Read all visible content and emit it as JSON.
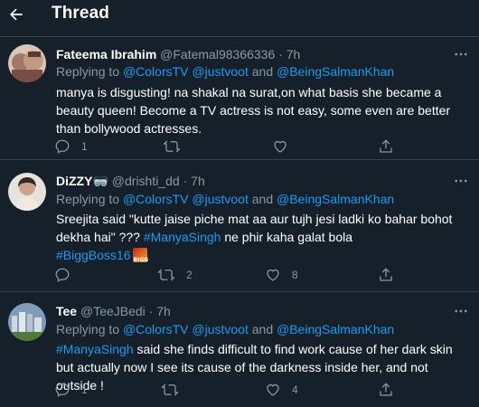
{
  "header": {
    "title": "Thread"
  },
  "tweets": [
    {
      "name": "Fateema Ibrahim",
      "handle": "@Fatemal98366336",
      "dot": "·",
      "time": "7h",
      "reply_prefix": "Replying to",
      "mentions": [
        "@ColorsTV",
        "@justvoot",
        "and",
        "@BeingSalmanKhan"
      ],
      "text": "manya is disgusting! na shakal na surat,on what basis she became a beauty queen! Become a TV actress is not easy, some even are better than bollywood actresses.",
      "replies": "1",
      "retweets": "",
      "likes": ""
    },
    {
      "name": "DiZZY",
      "name_emoji": "🥽",
      "handle": "@drishti_dd",
      "dot": "·",
      "time": "7h",
      "reply_prefix": "Replying to",
      "mentions": [
        "@ColorsTV",
        "@justvoot",
        "and",
        "@BeingSalmanKhan"
      ],
      "text_a": "Sreejita said \"kutte jaise piche mat aa aur tujh jesi ladki ko bahar bohot dekha hai\" ???",
      "hashtag_a": "#ManyaSingh",
      "text_b": "ne phir kaha galat bola",
      "hashtag_b": "#BiggBoss16",
      "boss_emoji_text": "BIGG",
      "replies": "",
      "retweets": "2",
      "likes": "8"
    },
    {
      "name": "Tee",
      "handle": "@TeeJBedi",
      "dot": "·",
      "time": "7h",
      "reply_prefix": "Replying to",
      "mentions": [
        "@ColorsTV",
        "@justvoot",
        "and",
        "@BeingSalmanKhan"
      ],
      "hashtag_a": "#ManyaSingh",
      "text_a": "said she finds difficult to find work cause of her dark skin but actually now I see its cause of the darkness inside her, and not outside !",
      "replies": "1",
      "retweets": "",
      "likes": "4"
    }
  ],
  "colors": {
    "background": "#15202b",
    "accent": "#1d9bf0",
    "muted": "#8899a6",
    "divider": "#38444d"
  },
  "icons": [
    "back-arrow-icon",
    "more-icon",
    "reply-icon",
    "retweet-icon",
    "like-icon",
    "share-icon"
  ]
}
